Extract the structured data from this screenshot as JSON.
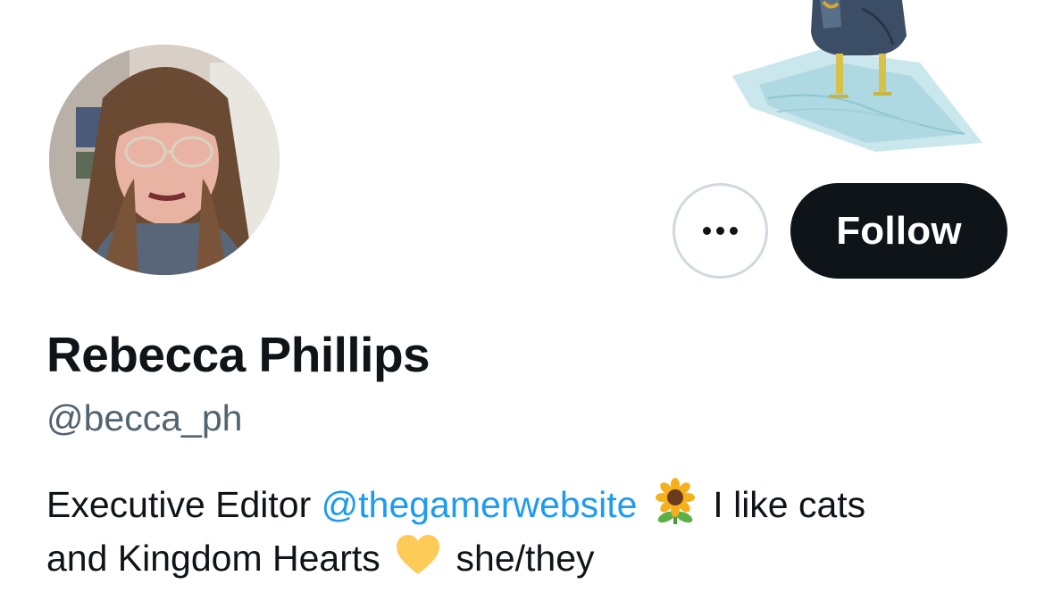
{
  "profile": {
    "display_name": "Rebecca Phillips",
    "handle": "@becca_ph",
    "bio": {
      "part1": "Executive Editor ",
      "mention": "@thegamerwebsite",
      "part2": " I like cats",
      "part3": "and Kingdom Hearts ",
      "part4": " she/they"
    }
  },
  "actions": {
    "follow_label": "Follow",
    "more_icon": "more-horizontal-icon"
  },
  "icons": {
    "sunflower": "sunflower-emoji-icon",
    "heart": "yellow-heart-emoji-icon"
  },
  "colors": {
    "text_primary": "#0f1419",
    "text_secondary": "#536471",
    "link": "#1d9bf0",
    "follow_bg": "#0f1419",
    "more_border": "#cfd9de"
  }
}
